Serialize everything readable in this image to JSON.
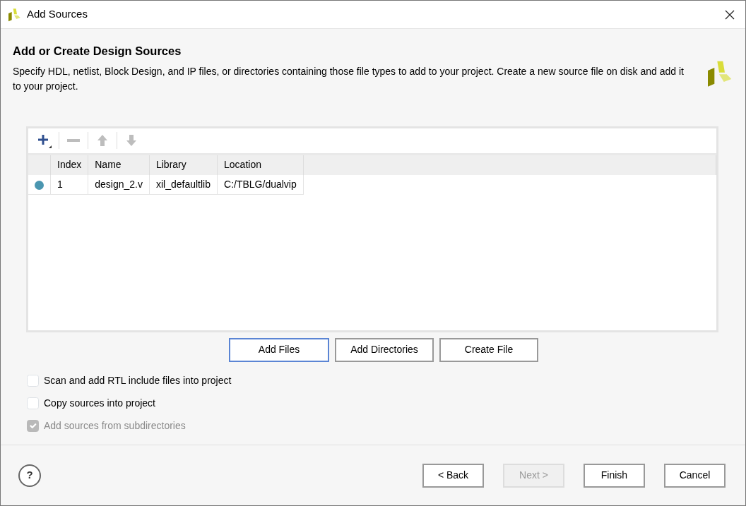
{
  "window": {
    "title": "Add Sources"
  },
  "header": {
    "title": "Add or Create Design Sources",
    "description": "Specify HDL, netlist, Block Design, and IP files, or directories containing those file types to add to your project. Create a new source file on disk and add it to your project."
  },
  "toolbar": [
    {
      "kind": "add",
      "disabled": false
    },
    {
      "kind": "remove",
      "disabled": true
    },
    {
      "kind": "up",
      "disabled": true
    },
    {
      "kind": "down",
      "disabled": true
    }
  ],
  "table": {
    "columns": [
      "Index",
      "Name",
      "Library",
      "Location"
    ],
    "rows": [
      {
        "color": "#4a96b0",
        "cells": [
          "1",
          "design_2.v",
          "xil_defaultlib",
          "C:/TBLG/dualvip"
        ]
      }
    ]
  },
  "file_buttons": [
    {
      "label": "Add Files",
      "focused": true
    },
    {
      "label": "Add Directories",
      "focused": false
    },
    {
      "label": "Create File",
      "focused": false
    }
  ],
  "options": [
    {
      "label": "Scan and add RTL include files into project",
      "checked": false,
      "disabled": false
    },
    {
      "label": "Copy sources into project",
      "checked": false,
      "disabled": false
    },
    {
      "label": "Add sources from subdirectories",
      "checked": true,
      "disabled": true
    }
  ],
  "footer": {
    "help": "?",
    "buttons": [
      {
        "label": "< Back",
        "disabled": false
      },
      {
        "label": "Next >",
        "disabled": true
      },
      {
        "label": "Finish",
        "disabled": false
      },
      {
        "label": "Cancel",
        "disabled": false
      }
    ]
  }
}
